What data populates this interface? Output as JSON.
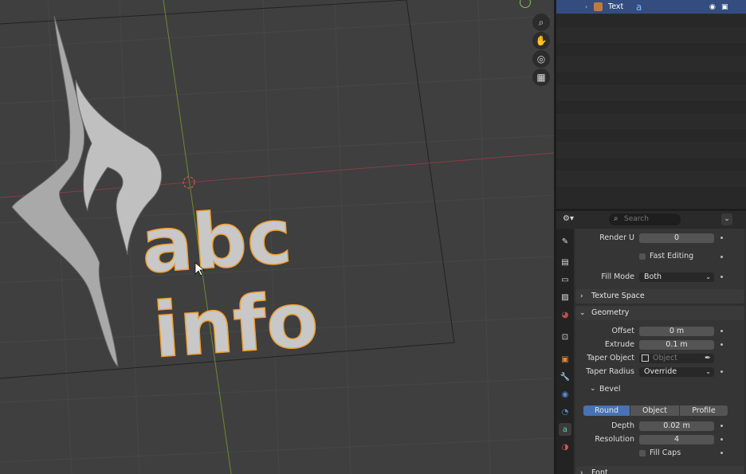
{
  "outliner": {
    "rows": [
      {
        "name": "Text",
        "selected": true
      }
    ]
  },
  "properties": {
    "search_placeholder": "Search",
    "render_u": {
      "label": "Render U",
      "value": "0"
    },
    "fast_editing": {
      "label": "Fast Editing",
      "checked": false
    },
    "fill_mode": {
      "label": "Fill Mode",
      "value": "Both"
    },
    "texture_space": {
      "label": "Texture Space"
    },
    "geometry": {
      "label": "Geometry",
      "offset": {
        "label": "Offset",
        "value": "0 m"
      },
      "extrude": {
        "label": "Extrude",
        "value": "0.1 m"
      },
      "taper_object": {
        "label": "Taper Object",
        "placeholder": "Object"
      },
      "taper_radius": {
        "label": "Taper Radius",
        "value": "Override"
      }
    },
    "bevel": {
      "label": "Bevel",
      "modes": [
        "Round",
        "Object",
        "Profile"
      ],
      "active_mode": "Round",
      "depth": {
        "label": "Depth",
        "value": "0.02 m"
      },
      "resolution": {
        "label": "Resolution",
        "value": "4"
      },
      "fill_caps": {
        "label": "Fill Caps",
        "checked": false
      }
    },
    "font": {
      "label": "Font"
    }
  },
  "viewport": {
    "text_line1": "abc",
    "text_line2": "info"
  }
}
